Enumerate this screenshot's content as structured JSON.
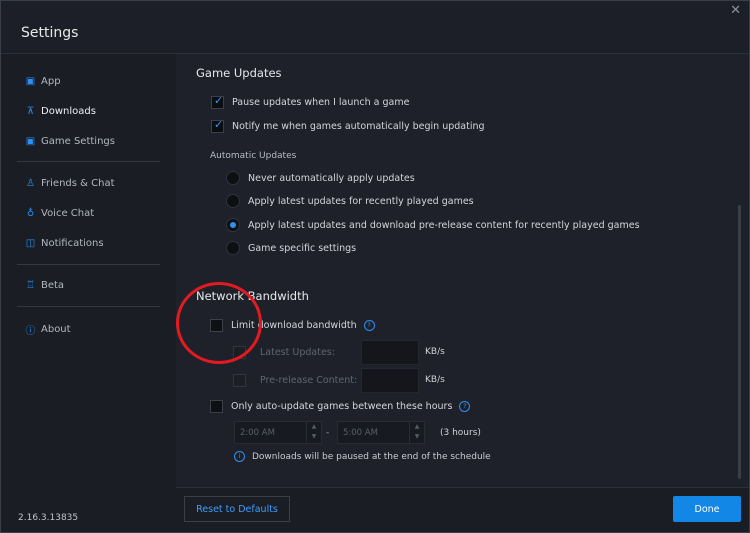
{
  "window": {
    "title": "Settings",
    "close_glyph": "✕"
  },
  "sidebar": {
    "items": [
      {
        "label": "App",
        "icon": "app-icon"
      },
      {
        "label": "Downloads",
        "icon": "downloads-icon",
        "active": true
      },
      {
        "label": "Game Settings",
        "icon": "game-settings-icon"
      },
      {
        "label": "Friends & Chat",
        "icon": "friends-icon"
      },
      {
        "label": "Voice Chat",
        "icon": "microphone-icon"
      },
      {
        "label": "Notifications",
        "icon": "notifications-icon"
      },
      {
        "label": "Beta",
        "icon": "beta-icon"
      },
      {
        "label": "About",
        "icon": "info-icon"
      }
    ],
    "version": "2.16.3.13835"
  },
  "game_updates": {
    "heading": "Game Updates",
    "pause_label": "Pause updates when I launch a game",
    "pause_checked": true,
    "notify_label": "Notify me when games automatically begin updating",
    "notify_checked": true,
    "auto_heading": "Automatic Updates",
    "options": [
      "Never automatically apply updates",
      "Apply latest updates for recently played games",
      "Apply latest updates and download pre-release content for recently played games",
      "Game specific settings"
    ],
    "selected_option": 2
  },
  "network": {
    "heading": "Network Bandwidth",
    "limit_label": "Limit download bandwidth",
    "limit_checked": false,
    "latest_label": "Latest Updates:",
    "prerelease_label": "Pre-release Content:",
    "unit": "KB/s",
    "only_label": "Only auto-update games between these hours",
    "only_checked": false,
    "start_time": "2:00 AM",
    "end_time": "5:00 AM",
    "dash": "-",
    "duration": "(3 hours)",
    "info": "Downloads will be paused at the end of the schedule"
  },
  "footer": {
    "reset_label": "Reset to Defaults",
    "done_label": "Done"
  },
  "colors": {
    "accent": "#2d8ff3",
    "annotation": "#e31b21"
  }
}
